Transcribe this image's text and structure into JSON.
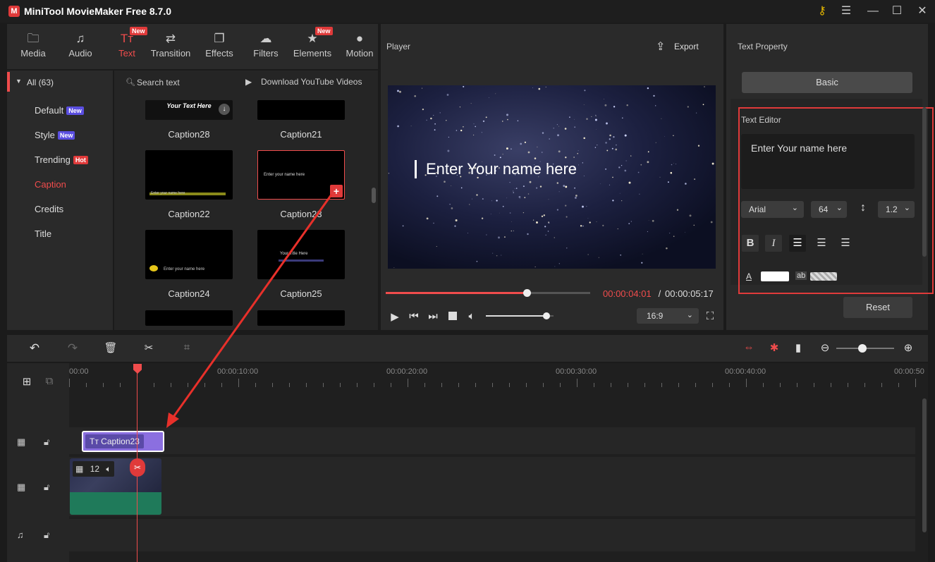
{
  "window": {
    "title": "MiniTool MovieMaker Free 8.7.0",
    "logo_text": "M"
  },
  "toolbar": {
    "tabs": [
      {
        "label": "Media",
        "icon": "folder-icon",
        "glyph": "🗀",
        "badge": ""
      },
      {
        "label": "Audio",
        "icon": "music-icon",
        "glyph": "♫",
        "badge": ""
      },
      {
        "label": "Text",
        "icon": "text-icon",
        "glyph": "Tт",
        "badge": "New"
      },
      {
        "label": "Transition",
        "icon": "transition-icon",
        "glyph": "⇄",
        "badge": ""
      },
      {
        "label": "Effects",
        "icon": "effects-icon",
        "glyph": "❐",
        "badge": ""
      },
      {
        "label": "Filters",
        "icon": "filters-icon",
        "glyph": "☁",
        "badge": ""
      },
      {
        "label": "Elements",
        "icon": "elements-icon",
        "glyph": "★",
        "badge": "New"
      },
      {
        "label": "Motion",
        "icon": "motion-icon",
        "glyph": "●",
        "badge": ""
      }
    ],
    "active_tab": "Text"
  },
  "categories": {
    "header": "All (63)",
    "items": [
      {
        "label": "Default",
        "badge": "New",
        "badge_type": "new"
      },
      {
        "label": "Style",
        "badge": "New",
        "badge_type": "new"
      },
      {
        "label": "Trending",
        "badge": "Hot",
        "badge_type": "hot"
      },
      {
        "label": "Caption",
        "badge": "",
        "badge_type": ""
      },
      {
        "label": "Credits",
        "badge": "",
        "badge_type": ""
      },
      {
        "label": "Title",
        "badge": "",
        "badge_type": ""
      }
    ],
    "active": "Caption"
  },
  "library": {
    "search_placeholder": "Search text",
    "download_label": "Download YouTube Videos",
    "thumbs": [
      {
        "label": "Caption28",
        "preview": "Your Text Here"
      },
      {
        "label": "Caption21",
        "preview": ""
      },
      {
        "label": "Caption22",
        "preview": "Enter your name here"
      },
      {
        "label": "Caption23",
        "preview": "Enter your name here"
      },
      {
        "label": "Caption24",
        "preview": "Enter your name here"
      },
      {
        "label": "Caption25",
        "preview": "Your Title Here"
      }
    ],
    "selected": "Caption23"
  },
  "player": {
    "title": "Player",
    "export_label": "Export",
    "overlay_text": "Enter Your name here",
    "time_current": "00:00:04:01",
    "time_separator": " / ",
    "time_total": "00:00:05:17",
    "progress": 0.69,
    "volume": 0.9,
    "aspect": "16:9"
  },
  "text_property": {
    "title": "Text Property",
    "tab_basic": "Basic",
    "editor_label": "Text Editor",
    "editor_value": "Enter Your name here",
    "font": "Arial",
    "size": "64",
    "line_spacing": "1.2",
    "color_label": "A",
    "bg_label": "ab",
    "reset_label": "Reset",
    "colors": {
      "highlight_border": "#e03a3a",
      "text_color": "#ffffff"
    }
  },
  "timeline": {
    "ticks": [
      "00:00",
      "00:00:10:00",
      "00:00:20:00",
      "00:00:30:00",
      "00:00:40:00",
      "00:00:50"
    ],
    "text_clip_label": "Caption23",
    "video_clip_count": "12",
    "zoom_level": 0.45
  },
  "colors": {
    "accent": "#f04c4c",
    "text_clip": "#8b6fe0",
    "video_bottom": "#1f7a5a"
  }
}
